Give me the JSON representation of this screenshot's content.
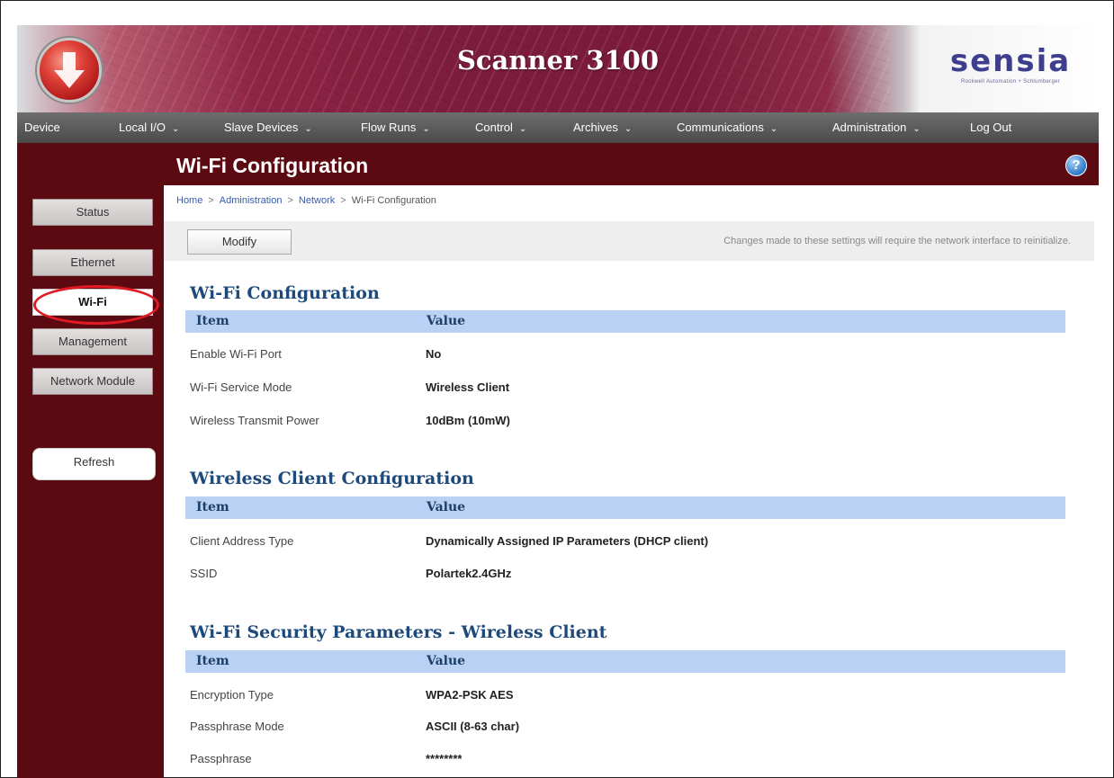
{
  "header": {
    "app_title": "Scanner 3100",
    "brand_name": "sensia",
    "brand_tagline": "Rockwell Automation + Schlumberger"
  },
  "nav": [
    {
      "label": "Device",
      "has_dropdown": false
    },
    {
      "label": "Local I/O",
      "has_dropdown": true
    },
    {
      "label": "Slave Devices",
      "has_dropdown": true
    },
    {
      "label": "Flow Runs",
      "has_dropdown": true
    },
    {
      "label": "Control",
      "has_dropdown": true
    },
    {
      "label": "Archives",
      "has_dropdown": true
    },
    {
      "label": "Communications",
      "has_dropdown": true
    },
    {
      "label": "Administration",
      "has_dropdown": true
    },
    {
      "label": "Log Out",
      "has_dropdown": false
    }
  ],
  "nav_chevron": "⌄",
  "page": {
    "title": "Wi-Fi Configuration",
    "help_symbol": "?"
  },
  "breadcrumb": {
    "items": [
      "Home",
      "Administration",
      "Network",
      "Wi-Fi Configuration"
    ],
    "separator": ">"
  },
  "sidebar": {
    "items": [
      "Status",
      "Ethernet",
      "Wi-Fi",
      "Management",
      "Network Module"
    ],
    "active": "Wi-Fi",
    "refresh_label": "Refresh"
  },
  "toolbar": {
    "modify_label": "Modify",
    "note": "Changes made to these settings will require the network interface to reinitialize."
  },
  "columns": {
    "item": "Item",
    "value": "Value"
  },
  "sections": [
    {
      "title": "Wi-Fi Configuration",
      "rows": [
        {
          "item": "Enable Wi-Fi Port",
          "value": "No"
        },
        {
          "item": "Wi-Fi Service Mode",
          "value": "Wireless Client"
        },
        {
          "item": "Wireless Transmit Power",
          "value": "10dBm (10mW)"
        }
      ]
    },
    {
      "title": "Wireless Client Configuration",
      "rows": [
        {
          "item": "Client Address Type",
          "value": "Dynamically Assigned IP Parameters (DHCP client)"
        },
        {
          "item": "SSID",
          "value": "Polartek2.4GHz"
        }
      ]
    },
    {
      "title": "Wi-Fi Security Parameters - Wireless Client",
      "rows": [
        {
          "item": "Encryption Type",
          "value": "WPA2-PSK AES"
        },
        {
          "item": "Passphrase Mode",
          "value": "ASCII (8-63 char)"
        },
        {
          "item": "Passphrase",
          "value": "********"
        }
      ]
    }
  ],
  "colors": {
    "maroon": "#5c0a12",
    "table_header": "#b9d1f2",
    "section_title": "#1d4a7a",
    "highlight": "#e01b24"
  }
}
